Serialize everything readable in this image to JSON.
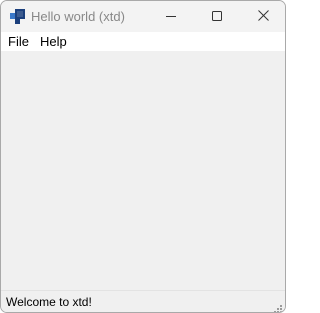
{
  "window": {
    "title": "Hello world (xtd)",
    "icon": "xtd-app-icon"
  },
  "titlebar": {
    "minimize_icon": "minimize-icon",
    "maximize_icon": "maximize-icon",
    "close_icon": "close-icon"
  },
  "menu": {
    "items": [
      {
        "label": "File"
      },
      {
        "label": "Help"
      }
    ]
  },
  "statusbar": {
    "text": "Welcome to xtd!",
    "grip_icon": "size-grip-icon"
  },
  "colors": {
    "client_background": "#f0f0f0",
    "menubar_background": "#ffffff",
    "title_text": "#888888",
    "icon_blue_dark": "#1b3f7c",
    "icon_blue_light": "#3a78c9"
  }
}
